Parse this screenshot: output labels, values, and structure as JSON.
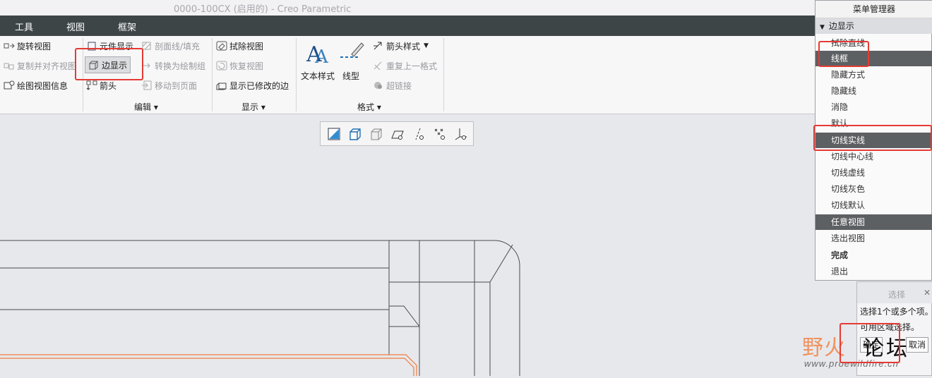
{
  "window": {
    "title": "0000-100CX (启用的) - Creo Parametric"
  },
  "tabs": [
    {
      "label": "工具"
    },
    {
      "label": "视图"
    },
    {
      "label": "框架"
    }
  ],
  "ribbon": {
    "col1": {
      "rotate_view": "旋转视图",
      "copy_align_view": "复制并对齐视图",
      "drawing_view_info": "绘图视图信息"
    },
    "edit": {
      "element_display": "元件显示",
      "edge_display": "边显示",
      "arrow": "箭头",
      "section_fill": "剖面线/填充",
      "convert_to_draw_group": "转换为绘制组",
      "move_to_page": "移动到页面",
      "group_label": "编辑"
    },
    "display": {
      "erase_view": "拭除视图",
      "restore_view": "恢复视图",
      "show_modified_edges": "显示已修改的边",
      "group_label": "显示"
    },
    "format": {
      "text_style": "文本样式",
      "line_style": "线型",
      "arrow_style": "箭头样式",
      "repeat_last_format": "重复上一格式",
      "hyperlink": "超链接",
      "group_label": "格式"
    }
  },
  "mini_toolbar": {
    "icons": [
      "shading-icon",
      "cube-icon",
      "hidden-cube-icon",
      "plane-display-icon",
      "axis-display-icon",
      "point-display-icon",
      "csys-display-icon"
    ]
  },
  "menu_manager": {
    "title": "菜单管理器",
    "section": "边显示",
    "items": [
      {
        "label": "拭除直线"
      },
      {
        "label": "线框"
      },
      {
        "label": "隐藏方式"
      },
      {
        "label": "隐藏线"
      },
      {
        "label": "消隐"
      },
      {
        "label": "默认"
      },
      {
        "label": "切线实线"
      },
      {
        "label": "切线中心线"
      },
      {
        "label": "切线虚线"
      },
      {
        "label": "切线灰色"
      },
      {
        "label": "切线默认"
      },
      {
        "label": "任意视图"
      },
      {
        "label": "选出视图"
      },
      {
        "label": "完成"
      },
      {
        "label": "退出"
      }
    ]
  },
  "select_dialog": {
    "title": "选择",
    "line1": "选择1个或多个项。",
    "line2": "可用区域选择。",
    "ok": "确定",
    "cancel": "取消"
  },
  "watermark": {
    "text1": "野火",
    "text2": "论坛",
    "url": "www.proewildfire.cn"
  },
  "colors": {
    "highlight_red": "#e53a33",
    "selected_menu": "#5d6063",
    "tab_bar": "#3d4547",
    "model_orange": "#f07b3a"
  }
}
